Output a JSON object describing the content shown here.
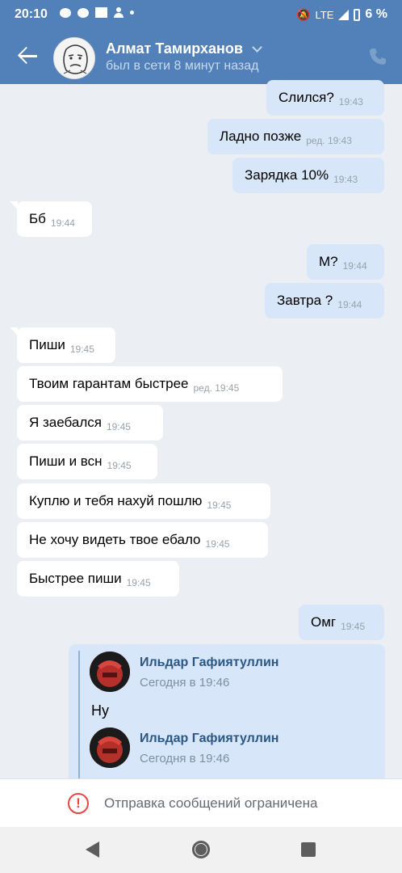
{
  "status": {
    "time": "20:10",
    "network": "LTE",
    "battery": "6 %",
    "icons": [
      "chat-bubble-icon",
      "chat-bubble-icon",
      "mail-icon",
      "person-icon",
      "dot-icon",
      "mute-icon",
      "signal-icon",
      "battery-icon"
    ]
  },
  "header": {
    "name": "Алмат Тамирханов",
    "last_seen": "был в сети 8 минут назад",
    "accent": "#5181b8"
  },
  "messages": [
    {
      "dir": "out",
      "text": "Слился?",
      "time": "19:43"
    },
    {
      "dir": "out",
      "text": "Ладно позже",
      "time": "ред. 19:43"
    },
    {
      "dir": "out",
      "text": "Зарядка 10%",
      "time": "19:43"
    },
    {
      "dir": "in",
      "text": "Бб",
      "time": "19:44"
    },
    {
      "dir": "out",
      "text": "М?",
      "time": "19:44"
    },
    {
      "dir": "out",
      "text": "Завтра ?",
      "time": "19:44"
    },
    {
      "dir": "in",
      "text": "Пиши",
      "time": "19:45"
    },
    {
      "dir": "in",
      "text": "Твоим гарантам быстрее",
      "time": "ред. 19:45"
    },
    {
      "dir": "in",
      "text": "Я заебался",
      "time": "19:45"
    },
    {
      "dir": "in",
      "text": "Пиши и всн",
      "time": "19:45"
    },
    {
      "dir": "in",
      "text": "Куплю и тебя нахуй пошлю",
      "time": "19:45"
    },
    {
      "dir": "in",
      "text": "Не хочу видеть твое ебало",
      "time": "19:45"
    },
    {
      "dir": "in",
      "text": "Быстрее пиши",
      "time": "19:45"
    },
    {
      "dir": "out",
      "text": "Омг",
      "time": "19:45"
    }
  ],
  "forwarded": [
    {
      "author": "Ильдар Гафиятуллин",
      "when": "Сегодня в 19:46",
      "text": "Ну"
    },
    {
      "author": "Ильдар Гафиятуллин",
      "when": "Сегодня в 19:46"
    }
  ],
  "restriction": {
    "label": "Отправка сообщений ограничена",
    "color": "#e64646"
  }
}
